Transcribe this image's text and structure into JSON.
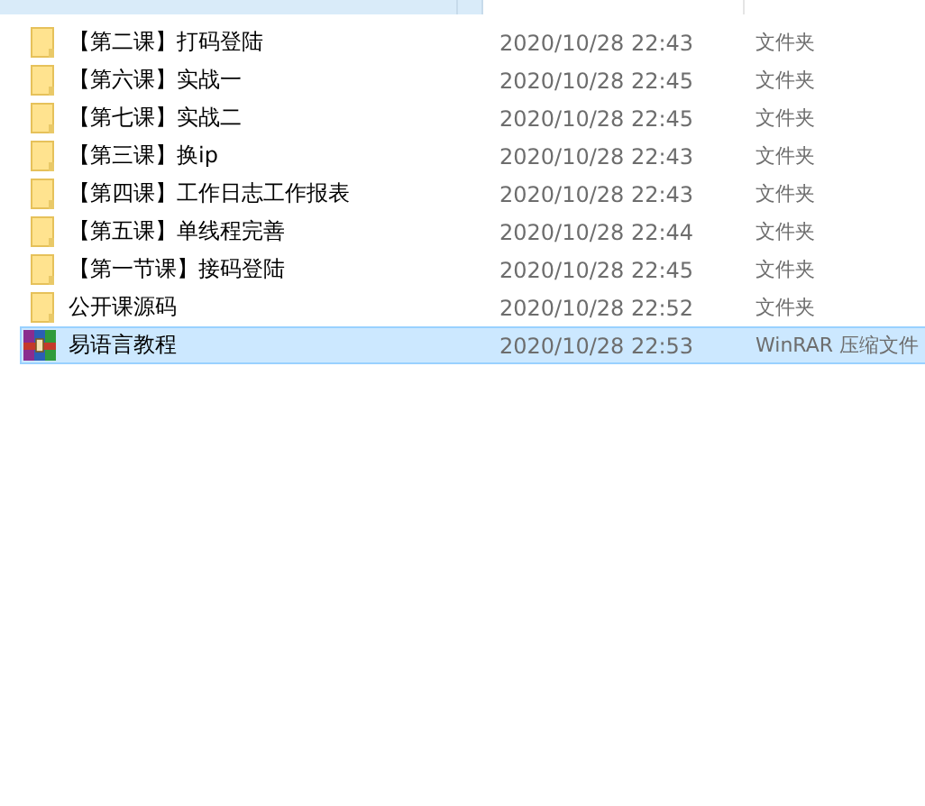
{
  "files": [
    {
      "name": "【第二课】打码登陆",
      "modified": "2020/10/28 22:43",
      "type": "文件夹",
      "kind": "folder",
      "selected": false
    },
    {
      "name": "【第六课】实战一",
      "modified": "2020/10/28 22:45",
      "type": "文件夹",
      "kind": "folder",
      "selected": false
    },
    {
      "name": "【第七课】实战二",
      "modified": "2020/10/28 22:45",
      "type": "文件夹",
      "kind": "folder",
      "selected": false
    },
    {
      "name": "【第三课】换ip",
      "modified": "2020/10/28 22:43",
      "type": "文件夹",
      "kind": "folder",
      "selected": false
    },
    {
      "name": "【第四课】工作日志工作报表",
      "modified": "2020/10/28 22:43",
      "type": "文件夹",
      "kind": "folder",
      "selected": false
    },
    {
      "name": "【第五课】单线程完善",
      "modified": "2020/10/28 22:44",
      "type": "文件夹",
      "kind": "folder",
      "selected": false
    },
    {
      "name": "【第一节课】接码登陆",
      "modified": "2020/10/28 22:45",
      "type": "文件夹",
      "kind": "folder",
      "selected": false
    },
    {
      "name": "公开课源码",
      "modified": "2020/10/28 22:52",
      "type": "文件夹",
      "kind": "folder",
      "selected": false
    },
    {
      "name": "易语言教程",
      "modified": "2020/10/28 22:53",
      "type": "WinRAR 压缩文件",
      "kind": "archive",
      "selected": true
    }
  ]
}
